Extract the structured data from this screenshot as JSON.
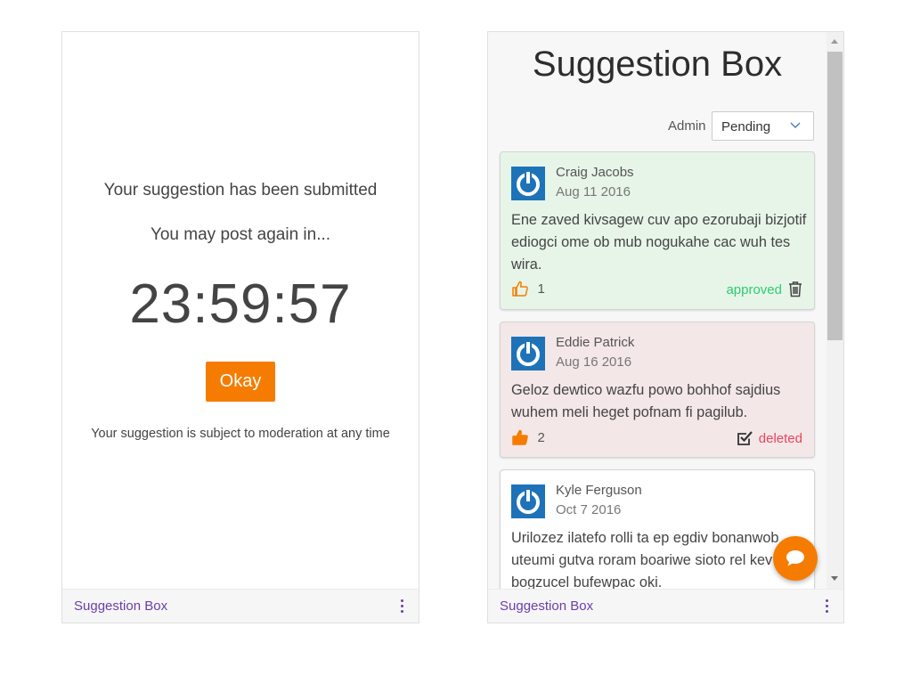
{
  "left": {
    "message": "Your suggestion has been submitted",
    "post_again": "You may post again in...",
    "countdown": "23:59:57",
    "okay_label": "Okay",
    "moderation_note": "Your suggestion is subject to moderation at any time",
    "footer_title": "Suggestion Box"
  },
  "right": {
    "title": "Suggestion Box",
    "admin_label": "Admin",
    "status_filter": "Pending",
    "footer_title": "Suggestion Box",
    "cards": [
      {
        "author": "Craig Jacobs",
        "date": "Aug 11 2016",
        "body": "Ene zaved kivsagew cuv apo ezorubaji bizjotif ediogci ome ob mub nogukahe cac wuh tes wira.",
        "likes": "1",
        "status": "approved"
      },
      {
        "author": "Eddie Patrick",
        "date": "Aug 16 2016",
        "body": "Geloz dewtico wazfu powo bohhof sajdius wuhem meli heget pofnam fi pagilub.",
        "likes": "2",
        "status": "deleted"
      },
      {
        "author": "Kyle Ferguson",
        "date": "Oct 7 2016",
        "body": "Urilozez ilatefo rolli ta ep egdiv bonanwob uteumi gutva roram boariwe sioto rel kev bogzucel bufewpac oki."
      }
    ]
  },
  "colors": {
    "accent": "#f57c00",
    "footer_text": "#6a3fa8",
    "approved": "#2ecc71",
    "deleted": "#e8465e",
    "avatar": "#1e72b8"
  },
  "icons": [
    "thumbs-up-icon",
    "trash-icon",
    "check-square-icon",
    "chevron-down-icon",
    "more-vert-icon",
    "chat-bubble-icon",
    "power-icon"
  ]
}
